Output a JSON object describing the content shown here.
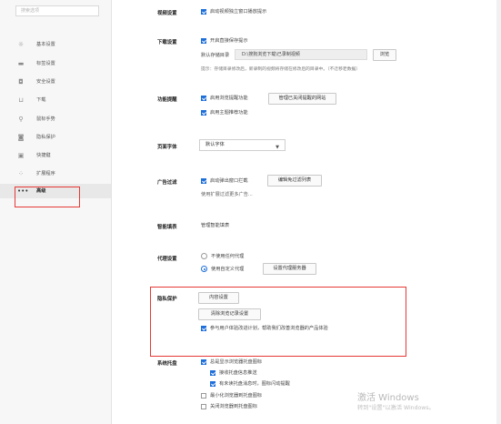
{
  "sidebar": {
    "search_placeholder": "搜索选项",
    "items": [
      {
        "label": "基本设置",
        "icon": "gear-icon"
      },
      {
        "label": "标签设置",
        "icon": "tab-icon"
      },
      {
        "label": "安全设置",
        "icon": "shield-icon"
      },
      {
        "label": "下载",
        "icon": "download-icon"
      },
      {
        "label": "鼠标手势",
        "icon": "mouse-icon"
      },
      {
        "label": "隐私保护",
        "icon": "privacy-shield-icon"
      },
      {
        "label": "快捷键",
        "icon": "keyboard-icon"
      },
      {
        "label": "扩展程序",
        "icon": "grid-icon"
      },
      {
        "label": "高级",
        "icon": "more-dots-icon"
      }
    ]
  },
  "video": {
    "section": "视频设置",
    "option1": "启动视频独立窗口播放提示"
  },
  "download": {
    "section": "下载设置",
    "option1": "开启直接保存提示",
    "default_dir_label": "默认存储目录",
    "default_dir_value": "D:\\搜狗浏览下载\\已录制视频",
    "browse_button": "浏览",
    "hint": "提示：存储目录修改后，新录制的视频将存储在修改后的目录中。（不迁移老数据）"
  },
  "feature_hint": {
    "section": "功能提醒",
    "option1": "启用浏览提醒功能",
    "manage_button": "管理已关闭提醒的网站",
    "option2": "启用主题推荐功能"
  },
  "font": {
    "section": "页面字体",
    "selected": "默认字体"
  },
  "adblock": {
    "section": "广告过滤",
    "option1": "启动弹出窗口拦截",
    "rules_button": "编辑免过滤列表",
    "extra": "使用扩展过滤更多广告..."
  },
  "smart": {
    "section": "智能填表",
    "link": "管理智能填表"
  },
  "proxy": {
    "section": "代理设置",
    "option1": "不使用任何代理",
    "option2": "使用自定义代理",
    "settings_button": "设置代理服务器"
  },
  "privacy": {
    "section": "隐私保护",
    "content_button": "内容设置",
    "clear_button": "清除浏览记录设置",
    "option1": "参与用户体验改进计划，帮助我们改善浏览器的产品体验"
  },
  "tray": {
    "section": "系统托盘",
    "option1": "总是显示浏览器托盘图标",
    "option2": "接收托盘信息推送",
    "option3": "有未读托盘消息时，图标闪动提醒",
    "option4": "最小化浏览器到托盘图标",
    "option5": "关闭浏览器到托盘图标"
  },
  "watermark": {
    "line1": "激活 Windows",
    "line2": "转到\"设置\"以激活 Windows。"
  },
  "colors": {
    "accent": "#1e6fd9",
    "highlight_border": "#e53935"
  }
}
